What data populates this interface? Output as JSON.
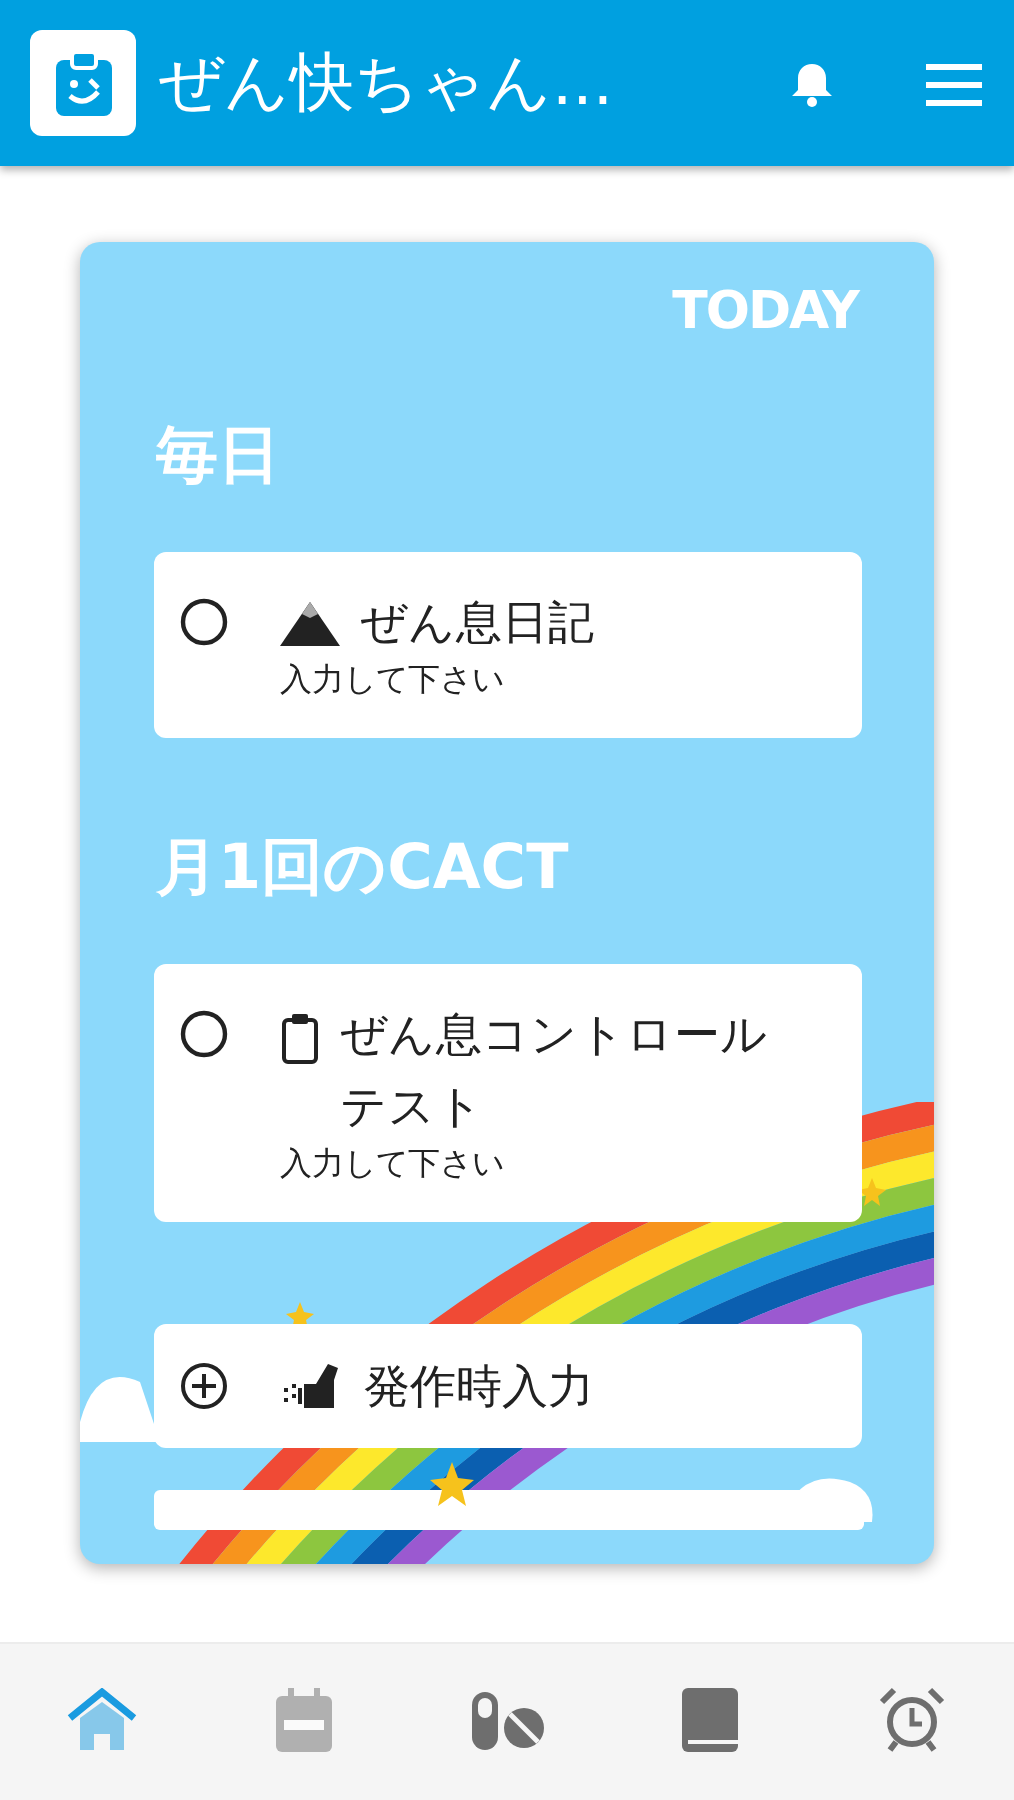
{
  "app_bar": {
    "title": "ぜん快ちゃん..."
  },
  "today_label": "TODAY",
  "sections": [
    {
      "heading": "毎日",
      "tasks": [
        {
          "kind": "diary",
          "title": "ぜん息日記",
          "status": "入力して下さい",
          "done": false
        }
      ]
    },
    {
      "heading": "月1回のCACT",
      "tasks": [
        {
          "kind": "test",
          "title": "ぜん息コントロールテスト",
          "status": "入力して下さい",
          "done": false
        }
      ]
    }
  ],
  "add_button": {
    "label": "発作時入力"
  },
  "nav": [
    {
      "kind": "home",
      "selected": true,
      "disabled": false
    },
    {
      "kind": "calendar",
      "selected": false,
      "disabled": true
    },
    {
      "kind": "medicine",
      "selected": false,
      "disabled": false
    },
    {
      "kind": "book",
      "selected": false,
      "disabled": false
    },
    {
      "kind": "alarm",
      "selected": false,
      "disabled": false
    }
  ]
}
